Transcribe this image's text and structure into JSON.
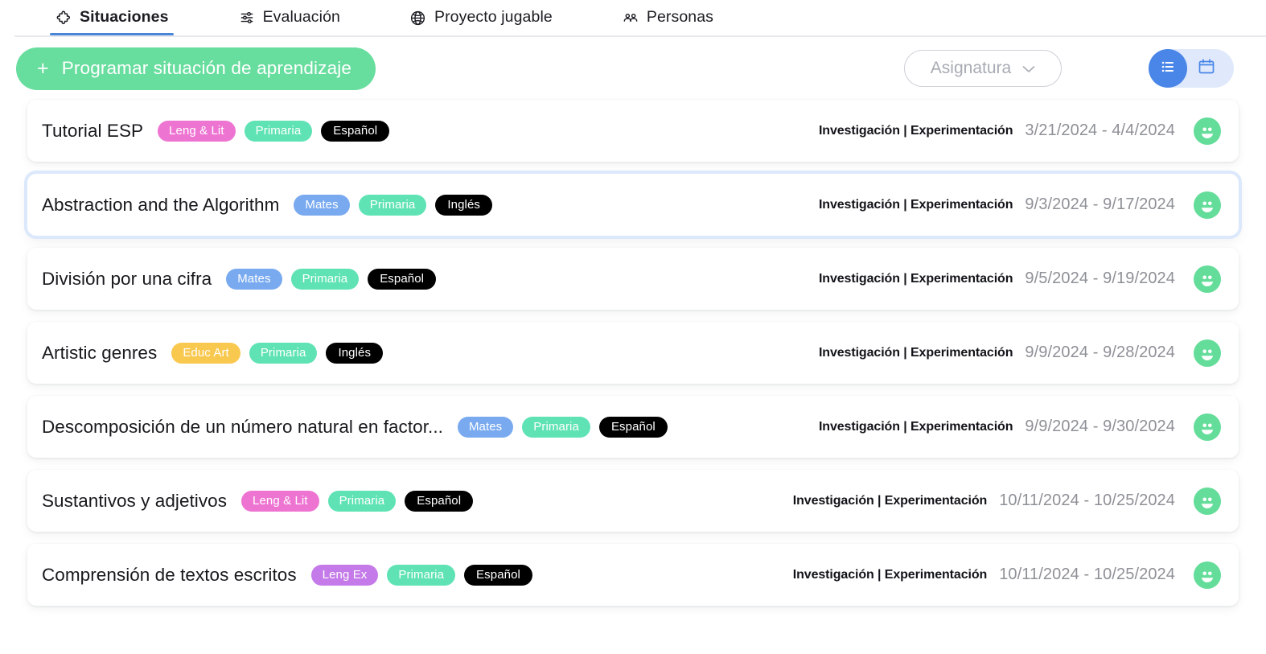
{
  "nav": {
    "tabs": [
      {
        "label": "Situaciones",
        "icon": "puzzle-piece-icon",
        "active": true
      },
      {
        "label": "Evaluación",
        "icon": "sliders-icon",
        "active": false
      },
      {
        "label": "Proyecto jugable",
        "icon": "globe-icon",
        "active": false
      },
      {
        "label": "Personas",
        "icon": "people-icon",
        "active": false
      }
    ]
  },
  "toolbar": {
    "create_button": {
      "label": "Programar situación de aprendizaje",
      "plus": "+"
    },
    "subject_filter": {
      "label": "Asignatura",
      "icon": "chevron-down-icon"
    },
    "view_toggle": {
      "list": {
        "icon": "list-view-icon",
        "active": true
      },
      "calendar": {
        "icon": "calendar-view-icon",
        "active": false
      }
    }
  },
  "colors": {
    "accent_green": "#67dd9e",
    "accent_blue": "#4a86e8",
    "tag_pink": "#ee74d2",
    "tag_mint": "#5fe3b4",
    "tag_blue": "#79aaf0",
    "tag_amber": "#f8c košice"
  },
  "list": {
    "rows": [
      {
        "title": "Tutorial ESP",
        "tags": [
          {
            "label": "Leng & Lit",
            "color": "#ee74d2"
          },
          {
            "label": "Primaria",
            "color": "#5fe3b4"
          },
          {
            "label": "Español",
            "color": "#000000"
          }
        ],
        "phase": "Investigación | Experimentación",
        "dates": "3/21/2024 - 4/4/2024",
        "avatar": "group-avatar",
        "selected": false
      },
      {
        "title": "Abstraction and the Algorithm",
        "tags": [
          {
            "label": "Mates",
            "color": "#79aaf0"
          },
          {
            "label": "Primaria",
            "color": "#5fe3b4"
          },
          {
            "label": "Inglés",
            "color": "#000000"
          }
        ],
        "phase": "Investigación | Experimentación",
        "dates": "9/3/2024 - 9/17/2024",
        "avatar": "group-avatar",
        "selected": true
      },
      {
        "title": "División por una cifra",
        "tags": [
          {
            "label": "Mates",
            "color": "#79aaf0"
          },
          {
            "label": "Primaria",
            "color": "#5fe3b4"
          },
          {
            "label": "Español",
            "color": "#000000"
          }
        ],
        "phase": "Investigación | Experimentación",
        "dates": "9/5/2024 - 9/19/2024",
        "avatar": "group-avatar",
        "selected": false
      },
      {
        "title": "Artistic genres",
        "tags": [
          {
            "label": "Educ Art",
            "color": "#f9c84f"
          },
          {
            "label": "Primaria",
            "color": "#5fe3b4"
          },
          {
            "label": "Inglés",
            "color": "#000000"
          }
        ],
        "phase": "Investigación | Experimentación",
        "dates": "9/9/2024 - 9/28/2024",
        "avatar": "group-avatar",
        "selected": false
      },
      {
        "title": "Descomposición de un número natural en factor...",
        "tags": [
          {
            "label": "Mates",
            "color": "#79aaf0"
          },
          {
            "label": "Primaria",
            "color": "#5fe3b4"
          },
          {
            "label": "Español",
            "color": "#000000"
          }
        ],
        "phase": "Investigación | Experimentación",
        "dates": "9/9/2024 - 9/30/2024",
        "avatar": "group-avatar",
        "selected": false
      },
      {
        "title": "Sustantivos y adjetivos",
        "tags": [
          {
            "label": "Leng & Lit",
            "color": "#ee74d2"
          },
          {
            "label": "Primaria",
            "color": "#5fe3b4"
          },
          {
            "label": "Español",
            "color": "#000000"
          }
        ],
        "phase": "Investigación | Experimentación",
        "dates": "10/11/2024 - 10/25/2024",
        "avatar": "group-avatar",
        "selected": false
      },
      {
        "title": "Comprensión de textos escritos",
        "tags": [
          {
            "label": "Leng Ex",
            "color": "#c47ae8"
          },
          {
            "label": "Primaria",
            "color": "#5fe3b4"
          },
          {
            "label": "Español",
            "color": "#000000"
          }
        ],
        "phase": "Investigación | Experimentación",
        "dates": "10/11/2024 - 10/25/2024",
        "avatar": "group-avatar",
        "selected": false
      }
    ]
  }
}
